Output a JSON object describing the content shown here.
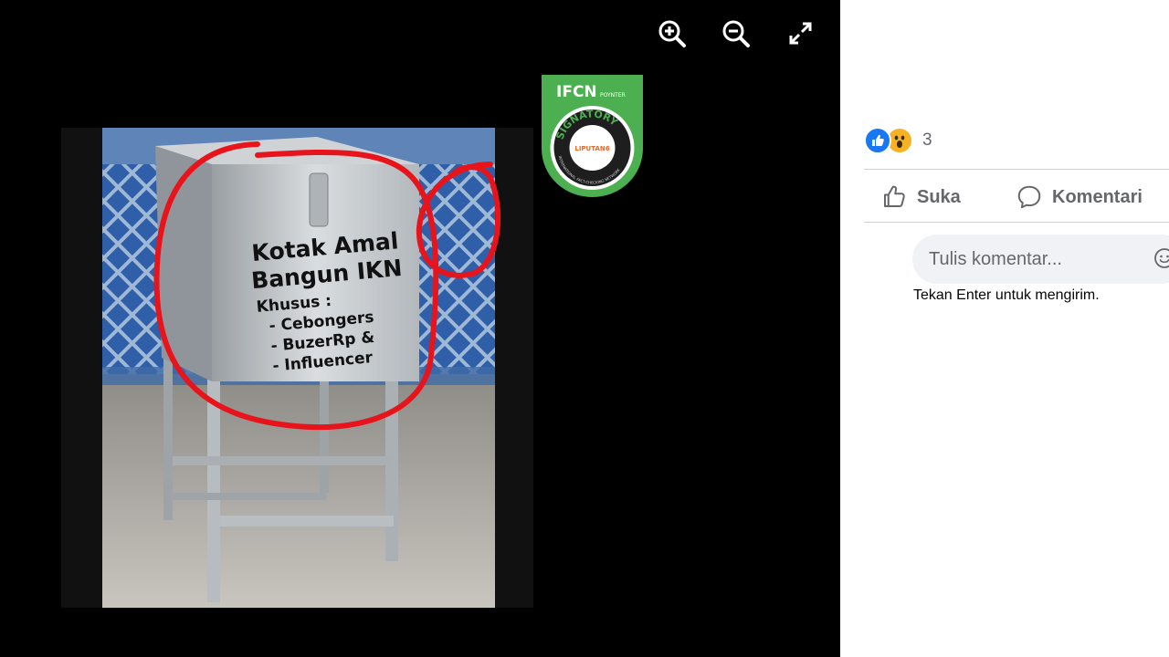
{
  "viewer": {
    "tools": [
      {
        "name": "zoom-in",
        "icon": "zoom-in-icon"
      },
      {
        "name": "zoom-out",
        "icon": "zoom-out-icon"
      },
      {
        "name": "fullscreen",
        "icon": "expand-icon"
      }
    ],
    "photo": {
      "box_text": [
        "Kotak Amal",
        "Bangun IKN",
        "Khusus :",
        "- Cebongers",
        "- BuzerRp &",
        "- Influencer"
      ],
      "annotation_color": "#e8141c"
    },
    "badge": {
      "org": "IFCN",
      "org_sub": "POYNTER",
      "ring_text": "SIGNATORY",
      "bottom_text": "INTERNATIONAL FACT-CHECKING NETWORK",
      "partner": "LIPUTAN6",
      "color": "#4caf50"
    }
  },
  "side": {
    "reaction_icons": [
      "like-icon",
      "wow-icon"
    ],
    "reaction_count": "3",
    "actions": {
      "like_label": "Suka",
      "comment_label": "Komentari"
    },
    "comment": {
      "placeholder": "Tulis komentar...",
      "hint": "Tekan Enter untuk mengirim."
    },
    "accent": "#1877f2"
  }
}
